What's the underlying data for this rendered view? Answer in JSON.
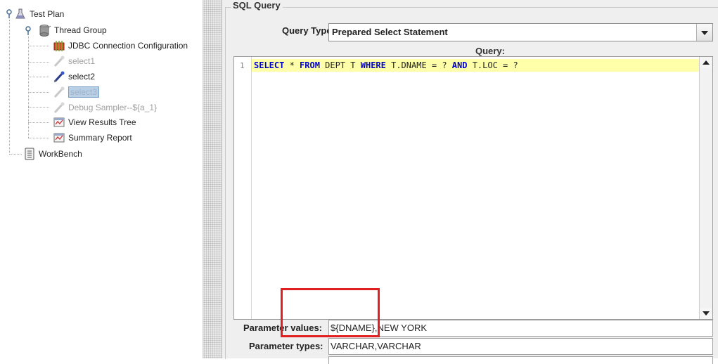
{
  "tree": {
    "items": [
      {
        "label": "Test Plan",
        "icon": "test-plan-icon"
      },
      {
        "label": "Thread Group",
        "icon": "thread-group-icon"
      },
      {
        "label": "JDBC Connection Configuration",
        "icon": "jdbc-config-icon"
      },
      {
        "label": "select1",
        "icon": "sampler-icon",
        "state": "disabled"
      },
      {
        "label": "select2",
        "icon": "sampler-icon",
        "state": "enabled"
      },
      {
        "label": "select3",
        "icon": "sampler-icon",
        "state": "selected-disabled"
      },
      {
        "label": "Debug Sampler--${a_1}",
        "icon": "sampler-icon",
        "state": "disabled"
      },
      {
        "label": "View Results Tree",
        "icon": "listener-icon"
      },
      {
        "label": "Summary Report",
        "icon": "listener-icon"
      },
      {
        "label": "WorkBench",
        "icon": "workbench-icon"
      }
    ]
  },
  "sql_query": {
    "legend": "SQL Query",
    "query_type_label": "Query Type:",
    "query_type_value": "Prepared Select Statement",
    "query_label": "Query:",
    "line_number": "1",
    "code_tokens": [
      {
        "t": "SELECT",
        "k": true
      },
      {
        "t": " * ",
        "k": false
      },
      {
        "t": "FROM",
        "k": true
      },
      {
        "t": " DEPT T ",
        "k": false
      },
      {
        "t": "WHERE",
        "k": true
      },
      {
        "t": " T.DNAME = ? ",
        "k": false
      },
      {
        "t": "AND",
        "k": true
      },
      {
        "t": " T.LOC = ?",
        "k": false
      }
    ],
    "param_values_label": "Parameter values:",
    "param_values": "${DNAME},NEW YORK",
    "param_types_label": "Parameter types:",
    "param_types": "VARCHAR,VARCHAR"
  },
  "colors": {
    "highlight_box": "#e02020",
    "keyword": "#0000cc",
    "current_line": "#ffffaa"
  }
}
